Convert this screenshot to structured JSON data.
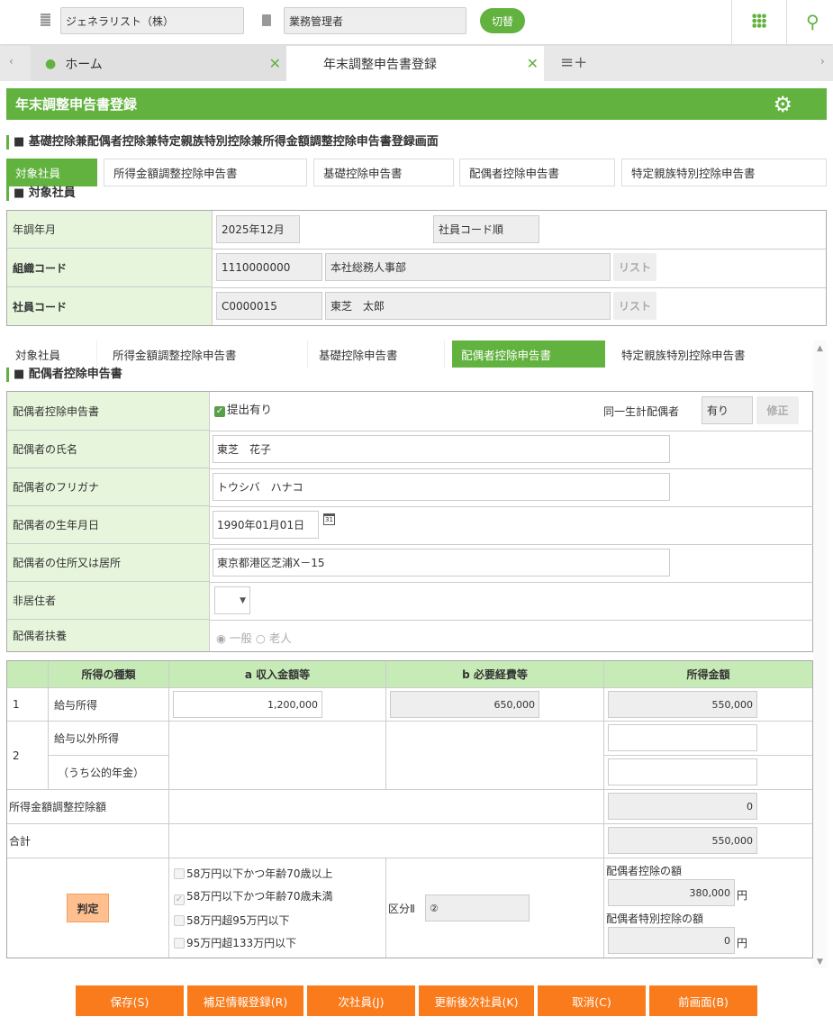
{
  "header": {
    "company": "ジェネラリスト（株）",
    "role": "業務管理者",
    "switch_label": "切替"
  },
  "tabs": [
    {
      "label": "ホーム"
    },
    {
      "label": "年末調整申告書登録"
    }
  ],
  "page_title": "年末調整申告書登録",
  "section_title": "■ 基礎控除兼配偶者控除兼特定親族特別控除兼所得金額調整控除申告書登録画面",
  "subtabs": [
    "対象社員",
    "所得金額調整控除申告書",
    "基礎控除申告書",
    "配偶者控除申告書",
    "特定親族特別控除申告書"
  ],
  "employee": {
    "heading": "■ 対象社員",
    "year_label": "年調年月",
    "year_value": "2025年12月",
    "sort_value": "社員コード順",
    "org_label": "組織コード",
    "org_code": "1110000000",
    "org_name": "本社総務人事部",
    "list_label": "リスト",
    "emp_label": "社員コード",
    "emp_code": "C0000015",
    "emp_name": "東芝　太郎"
  },
  "spouse": {
    "heading": "■ 配偶者控除申告書",
    "form_label": "配偶者控除申告書",
    "submitted": "提出有り",
    "same_label": "同一生計配偶者",
    "same_value": "有り",
    "edit_label": "修正",
    "name_label": "配偶者の氏名",
    "name_value": "東芝　花子",
    "kana_label": "配偶者のフリガナ",
    "kana_value": "トウシバ　ハナコ",
    "birth_label": "配偶者の生年月日",
    "birth_value": "1990年01月01日",
    "addr_label": "配偶者の住所又は居所",
    "addr_value": "東京都港区芝浦X－15",
    "nonres_label": "非居住者",
    "dep_label": "配偶者扶養",
    "dep_general": "一般",
    "dep_elder": "老人"
  },
  "income": {
    "h_type": "所得の種類",
    "h_a": "a 収入金額等",
    "h_b": "b 必要経費等",
    "h_income": "所得金額",
    "r1_no": "1",
    "r1_type": "給与所得",
    "r1_a": "1,200,000",
    "r1_b": "650,000",
    "r1_income": "550,000",
    "r2_no": "2",
    "r2_type": "給与以外所得",
    "r2_sub": "（うち公的年金）",
    "adj_label": "所得金額調整控除額",
    "adj_value": "0",
    "total_label": "合計",
    "total_value": "550,000",
    "judge_label": "判定",
    "opts": [
      "58万円以下かつ年齢70歳以上",
      "58万円以下かつ年齢70歳未満",
      "58万円超95万円以下",
      "95万円超133万円以下"
    ],
    "kubun_label": "区分Ⅱ",
    "kubun_value": "②",
    "ded_label": "配偶者控除の額",
    "ded_value": "380,000",
    "sp_label": "配偶者特別控除の額",
    "sp_value": "0",
    "yen": "円"
  },
  "buttons": [
    "保存(S)",
    "補足情報登録(R)",
    "次社員(J)",
    "更新後次社員(K)",
    "取消(C)",
    "前画面(B)"
  ]
}
